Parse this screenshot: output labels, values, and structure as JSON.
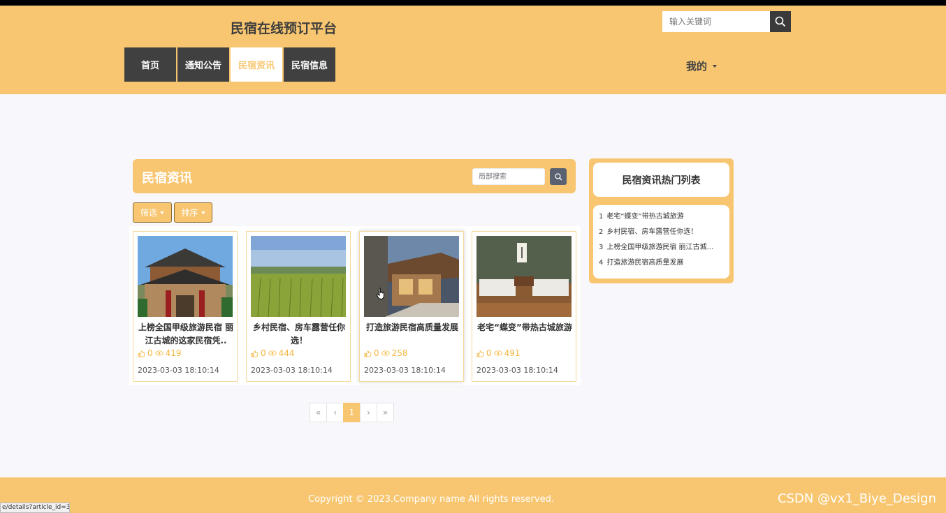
{
  "header": {
    "site_title": "民宿在线预订平台",
    "search_placeholder": "输入关键词",
    "nav": [
      {
        "label": "首页",
        "active": false
      },
      {
        "label": "通知公告",
        "active": false
      },
      {
        "label": "民宿资讯",
        "active": true
      },
      {
        "label": "民宿信息",
        "active": false
      }
    ],
    "mine_label": "我的"
  },
  "news": {
    "title": "民宿资讯",
    "local_search_placeholder": "局部搜索",
    "filter_label": "筛选",
    "sort_label": "排序",
    "cards": [
      {
        "title": "上榜全国甲级旅游民宿 丽江古城的这家民宿凭..",
        "likes": "0",
        "views": "419",
        "date": "2023-03-03 18:10:14",
        "image": "naxi-courtyard-photo"
      },
      {
        "title": "乡村民宿、房车露营任你选！",
        "likes": "0",
        "views": "444",
        "date": "2023-03-03 18:10:14",
        "image": "rice-field-photo"
      },
      {
        "title": "打造旅游民宿高质量发展",
        "likes": "0",
        "views": "258",
        "date": "2023-03-03 18:10:14",
        "image": "wooden-house-photo"
      },
      {
        "title": "老宅“蝶变”带热古城旅游",
        "likes": "0",
        "views": "491",
        "date": "2023-03-03 18:10:14",
        "image": "guest-room-photo"
      }
    ]
  },
  "pagination": {
    "first": "«",
    "prev": "‹",
    "current": "1",
    "next": "›",
    "last": "»"
  },
  "hot": {
    "title": "民宿资讯热门列表",
    "items": [
      {
        "num": "1",
        "text": "老宅“蝶变”带热古城旅游"
      },
      {
        "num": "2",
        "text": "乡村民宿、房车露营任你选！"
      },
      {
        "num": "3",
        "text": "上榜全国甲级旅游民宿 丽江古城..."
      },
      {
        "num": "4",
        "text": "打造旅游民宿高质量发展"
      }
    ]
  },
  "footer": {
    "copyright": "Copyright © 2023.Company name All rights reserved.",
    "watermark": "CSDN @vx1_Biye_Design"
  },
  "statusbar": {
    "url": "e/details?article_id=3"
  },
  "colors": {
    "accent": "#f8c670",
    "nav_dark": "#404040",
    "background": "#f8f7fb"
  }
}
